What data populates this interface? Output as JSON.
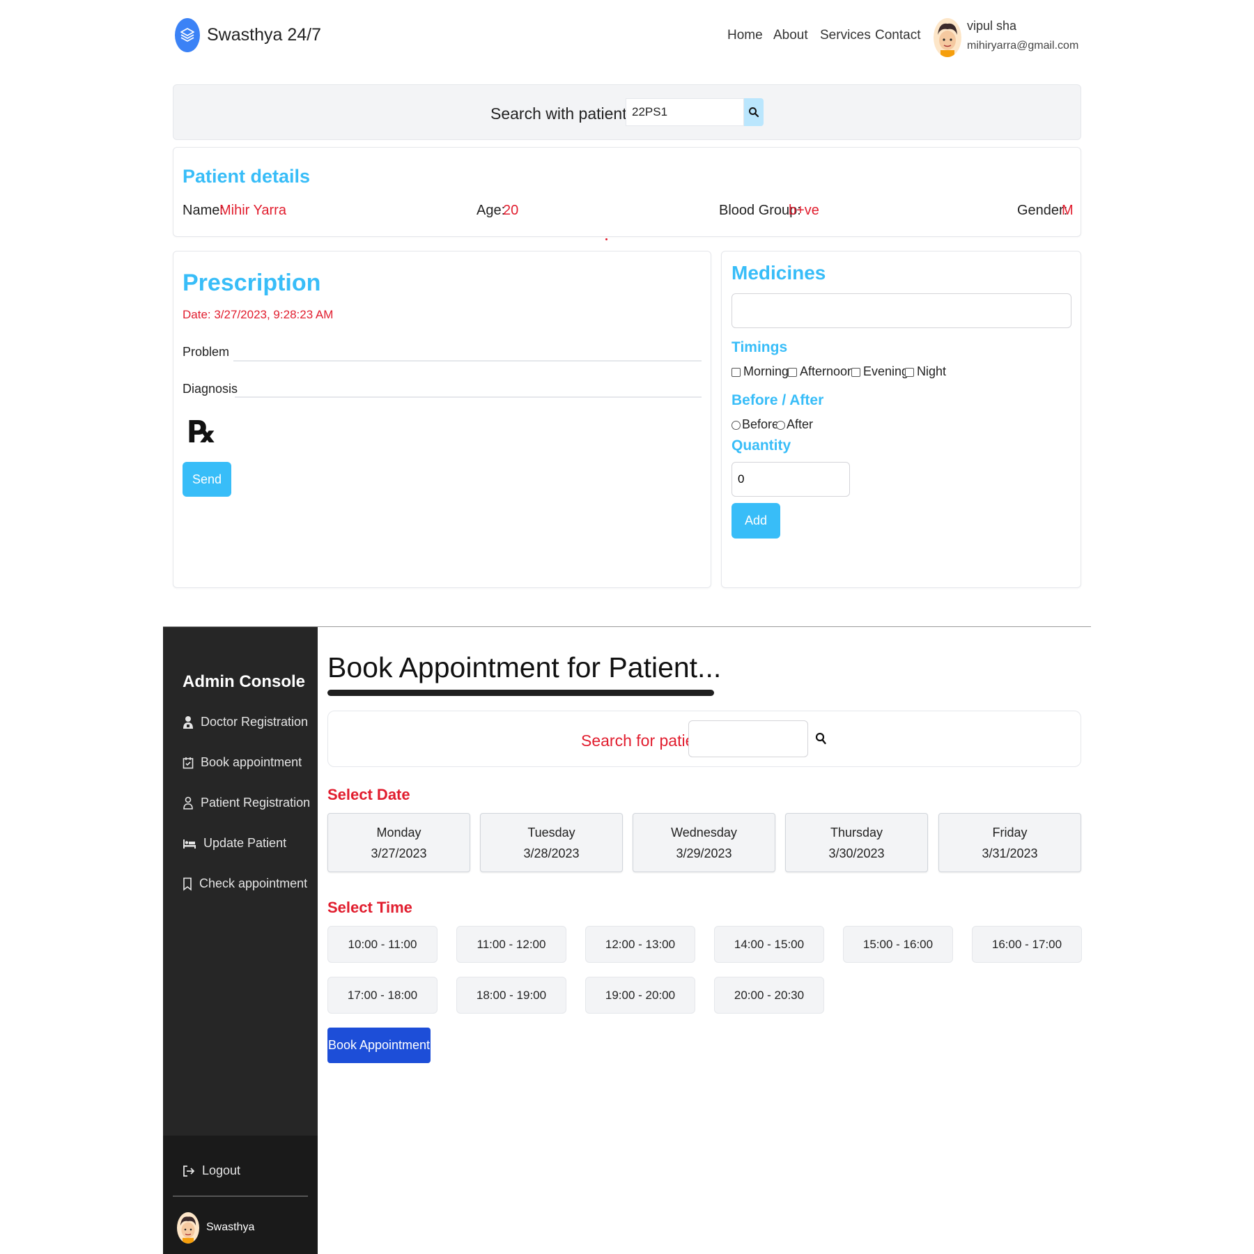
{
  "header": {
    "brand": "Swasthya 24/7",
    "nav": [
      "Home",
      "About",
      "Services",
      "Contact"
    ],
    "user": {
      "name": "vipul sha",
      "email": "mihiryarra@gmail.com"
    }
  },
  "search": {
    "label": "Search with patient's ID",
    "value": "22PS1"
  },
  "patient": {
    "heading": "Patient details",
    "name_label": "Name:",
    "name": "Mihir Yarra",
    "age_label": "Age:",
    "age": "20",
    "blood_label": "Blood Group:",
    "blood": "b+ve",
    "gender_label": "Gender:",
    "gender": "M"
  },
  "prescription": {
    "heading": "Prescription",
    "date": "Date: 3/27/2023, 9:28:23 AM",
    "problem_label": "Problem",
    "diagnosis_label": "Diagnosis",
    "rx": "℞",
    "send_label": "Send"
  },
  "medicines": {
    "heading": "Medicines",
    "timings_label": "Timings",
    "timings": [
      "Morning",
      "Afternoon",
      "Evening",
      "Night"
    ],
    "before_after_label": "Before / After",
    "before_after": [
      "Before",
      "After"
    ],
    "quantity_label": "Quantity",
    "quantity": "0",
    "add_label": "Add"
  },
  "admin": {
    "title": "Admin Console",
    "items": [
      "Doctor Registration",
      "Book appointment",
      "Patient Registration",
      "Update Patient",
      "Check appointment"
    ],
    "logout": "Logout",
    "profile_name": "Swasthya"
  },
  "booking": {
    "title": "Book Appointment for Patient...",
    "search_label": "Search for patient",
    "select_date": "Select Date",
    "dates": [
      {
        "day": "Monday",
        "date": "3/27/2023"
      },
      {
        "day": "Tuesday",
        "date": "3/28/2023"
      },
      {
        "day": "Wednesday",
        "date": "3/29/2023"
      },
      {
        "day": "Thursday",
        "date": "3/30/2023"
      },
      {
        "day": "Friday",
        "date": "3/31/2023"
      }
    ],
    "select_time": "Select Time",
    "times": [
      "10:00 - 11:00",
      "11:00 - 12:00",
      "12:00 - 13:00",
      "14:00 - 15:00",
      "15:00 - 16:00",
      "16:00 - 17:00",
      "17:00 - 18:00",
      "18:00 - 19:00",
      "19:00 - 20:00",
      "20:00 - 20:30"
    ],
    "book_label": "Book Appointment"
  },
  "colors": {
    "accent_blue": "#38bdf8",
    "brand_blue": "#3b82f6",
    "red": "#e11d2e",
    "book_button": "#1d4ed8",
    "sidebar": "#262626"
  },
  "icons": [
    "layers-icon",
    "search-icon",
    "avatar",
    "user-icon",
    "calendar-check-icon",
    "person-icon",
    "bed-icon",
    "bookmark-icon",
    "logout-icon"
  ]
}
